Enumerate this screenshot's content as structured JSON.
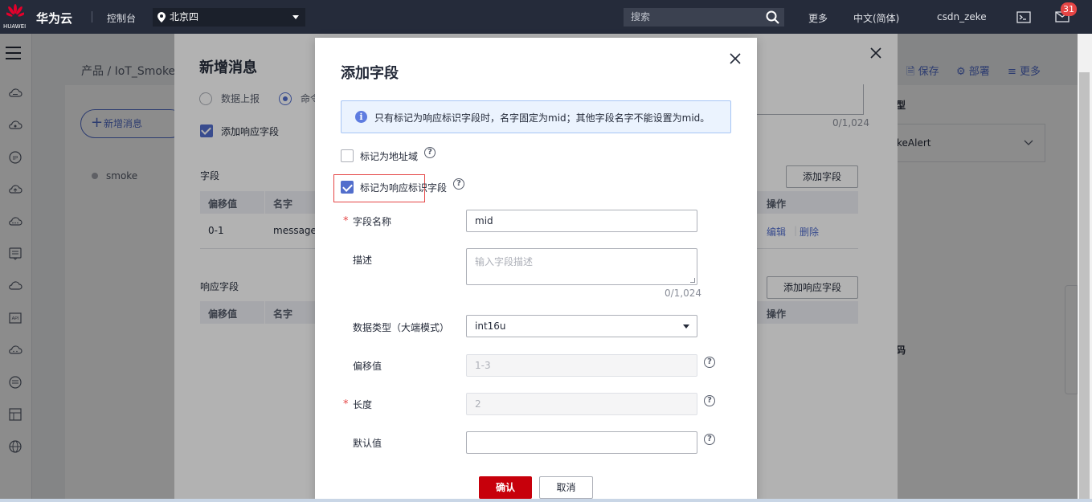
{
  "topbar": {
    "brand": "华为云",
    "logo_text": "HUAWEI",
    "console": "控制台",
    "region": "北京四",
    "search_placeholder": "搜索",
    "more": "更多",
    "language": "中文(简体)",
    "username": "csdn_zeke",
    "notification_count": "31"
  },
  "background": {
    "breadcrumb": "产品 / IoT_Smoke",
    "new_message_button": "新增消息",
    "message_item": "smoke",
    "actions": [
      "保存",
      "部署",
      "更多"
    ],
    "right_panel_snippets": [
      "型",
      "keAlert",
      "码"
    ]
  },
  "dialog_message": {
    "title": "新增消息",
    "radio_options": [
      "数据上报",
      "命令"
    ],
    "add_response_checkbox": "添加响应字段",
    "fields_section": "字段",
    "add_field_button": "添加字段",
    "columns": [
      "偏移值",
      "名字",
      "操作"
    ],
    "row": {
      "offset": "0-1",
      "name": "messageI",
      "edit": "编辑",
      "delete": "删除"
    },
    "response_section": "响应字段",
    "add_response_button": "添加响应字段",
    "response_columns": [
      "偏移值",
      "名字",
      "操作"
    ],
    "desc_counter": "0/1,024"
  },
  "dialog_field": {
    "title": "添加字段",
    "info": "只有标记为响应标识字段时，名字固定为mid；其他字段名字不能设置为mid。",
    "mark_address": "标记为地址域",
    "mark_response_id": "标记为响应标识字段",
    "field_name_label": "字段名称",
    "field_name_value": "mid",
    "description_label": "描述",
    "description_placeholder": "输入字段描述",
    "description_counter": "0/1,024",
    "data_type_label": "数据类型（大端模式）",
    "data_type_value": "int16u",
    "offset_label": "偏移值",
    "offset_value": "1-3",
    "length_label": "长度",
    "length_value": "2",
    "default_label": "默认值",
    "default_value": "",
    "confirm": "确认",
    "cancel": "取消"
  },
  "colors": {
    "topbar_bg": "#252b3a",
    "accent_blue": "#526ecc",
    "confirm_red": "#c7000b",
    "badge_red": "#e54545"
  }
}
